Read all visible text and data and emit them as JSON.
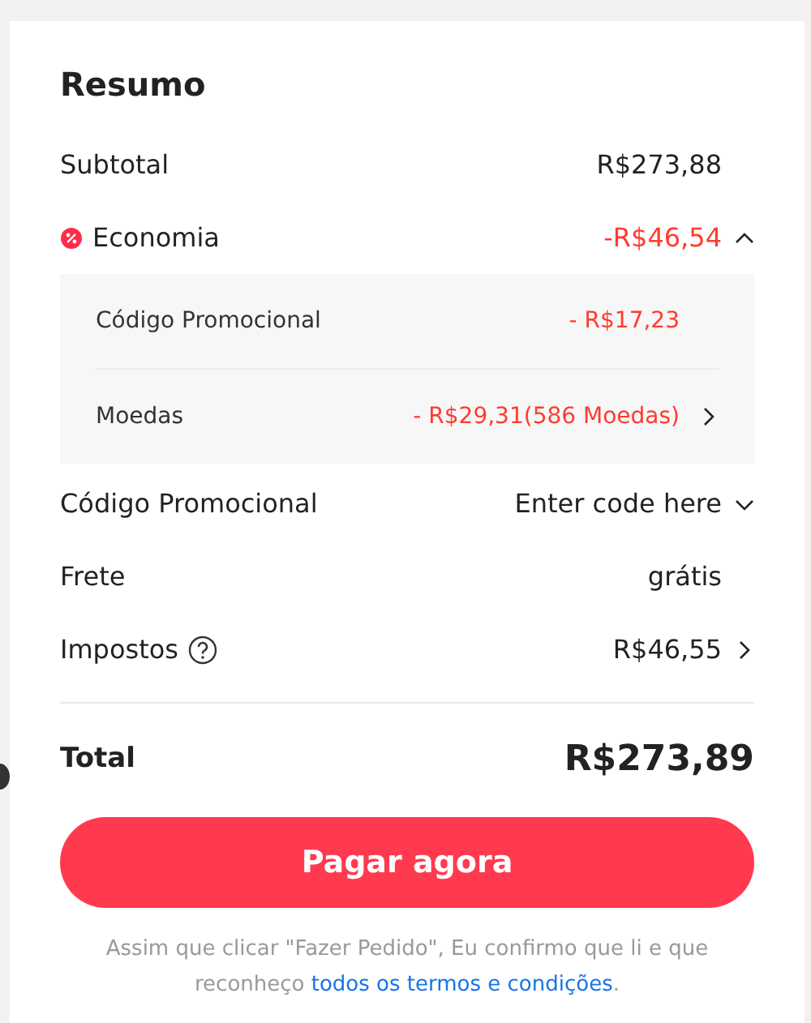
{
  "title": "Resumo",
  "rows": [
    {
      "kind": "plain",
      "label": "Subtotal",
      "value": "R$273,88"
    },
    {
      "kind": "discount",
      "label": "Economia",
      "value": "-R$46,54",
      "expanded": true,
      "children": [
        {
          "label": "Código Promocional",
          "value": "- R$17,23",
          "arrow": false
        },
        {
          "label": "Moedas",
          "value": "- R$29,31(586 Moedas)",
          "arrow": true
        }
      ]
    },
    {
      "kind": "code",
      "label": "Código Promocional",
      "placeholder": "Enter code here"
    },
    {
      "kind": "plain",
      "label": "Frete",
      "value": "grátis"
    },
    {
      "kind": "tax",
      "label": "Impostos",
      "value": "R$46,55"
    }
  ],
  "total": {
    "label": "Total",
    "value": "R$273,89"
  },
  "button": "Pagar agora",
  "notice": {
    "text": "Assim que clicar \"Fazer Pedido\", Eu confirmo que li e que reconheço ",
    "link": "todos os termos e condições",
    "end": "."
  }
}
